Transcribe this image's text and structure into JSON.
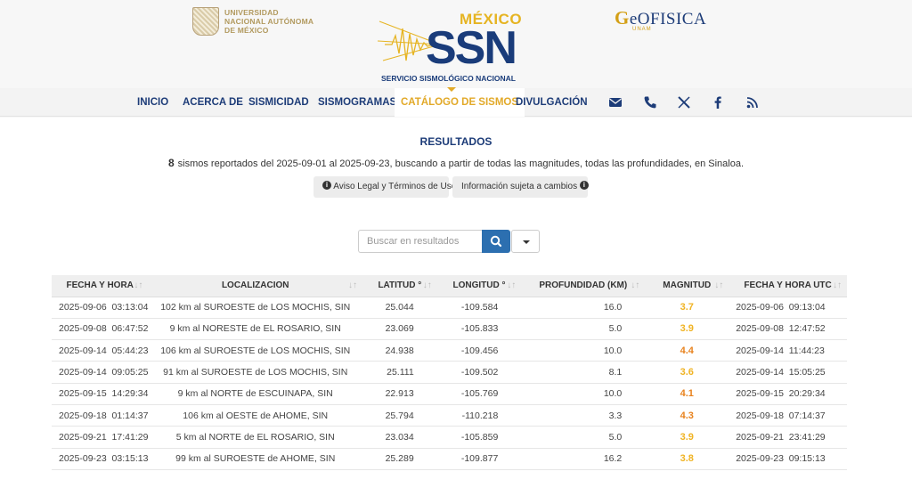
{
  "header": {
    "unam_text": "UNIVERSIDAD NACIONAL AUTÓNOMA DE MÉXICO",
    "ssn_top": "MÉXICO",
    "ssn_big": "SSN",
    "ssn_sub": "SERVICIO SISMOLÓGICO NACIONAL",
    "geo_g": "G",
    "geo_rest": "eOFISICA",
    "geo_sub": "UNAM"
  },
  "nav": {
    "items": [
      "INICIO",
      "ACERCA DE",
      "SISMICIDAD",
      "SISMOGRAMAS",
      "CATÁLOGO DE SISMOS",
      "DIVULGACIÓN"
    ],
    "active": "CATÁLOGO DE SISMOS",
    "icons": [
      "email-icon",
      "phone-icon",
      "x-twitter-icon",
      "facebook-icon",
      "rss-icon"
    ]
  },
  "results": {
    "title": "RESULTADOS",
    "count": "8",
    "description": "sismos reportados del 2025-09-01 al 2025-09-23, buscando a partir de todas las magnitudes, todas las profundidades, en Sinaloa.",
    "legal_label": "Aviso Legal y Términos de Uso",
    "changes_label": "Información sujeta a cambios",
    "info_glyph": "i"
  },
  "search": {
    "placeholder": "Buscar en resultados"
  },
  "colors": {
    "primary": "#1d3c78",
    "accent": "#e2a928",
    "button": "#2c6fb0",
    "mag_mid": "#f0b323",
    "mag_high": "#e8821d"
  },
  "table": {
    "sort_glyph": "↓↑",
    "headers": [
      "FECHA Y HORA",
      "LOCALIZACION",
      "LATITUD °",
      "LONGITUD °",
      "PROFUNDIDAD (KM)",
      "MAGNITUD",
      "FECHA Y HORA UTC"
    ],
    "rows": [
      [
        "2025-09-06  03:13:04",
        "102 km al SUROESTE de LOS MOCHIS, SIN",
        "25.044",
        "-109.584",
        "16.0",
        "3.7",
        "2025-09-06  09:13:04"
      ],
      [
        "2025-09-08  06:47:52",
        "9 km al NORESTE de EL ROSARIO, SIN",
        "23.069",
        "-105.833",
        "5.0",
        "3.9",
        "2025-09-08  12:47:52"
      ],
      [
        "2025-09-14  05:44:23",
        "106 km al SUROESTE de LOS MOCHIS, SIN",
        "24.938",
        "-109.456",
        "10.0",
        "4.4",
        "2025-09-14  11:44:23"
      ],
      [
        "2025-09-14  09:05:25",
        "91 km al SUROESTE de LOS MOCHIS, SIN",
        "25.111",
        "-109.502",
        "8.1",
        "3.6",
        "2025-09-14  15:05:25"
      ],
      [
        "2025-09-15  14:29:34",
        "9 km al NORTE de ESCUINAPA, SIN",
        "22.913",
        "-105.769",
        "10.0",
        "4.1",
        "2025-09-15  20:29:34"
      ],
      [
        "2025-09-18  01:14:37",
        "106 km al OESTE de AHOME, SIN",
        "25.794",
        "-110.218",
        "3.3",
        "4.3",
        "2025-09-18  07:14:37"
      ],
      [
        "2025-09-21  17:41:29",
        "5 km al NORTE de EL ROSARIO, SIN",
        "23.034",
        "-105.859",
        "5.0",
        "3.9",
        "2025-09-21  23:41:29"
      ],
      [
        "2025-09-23  03:15:13",
        "99 km al SUROESTE de AHOME, SIN",
        "25.289",
        "-109.877",
        "16.2",
        "3.8",
        "2025-09-23  09:15:13"
      ]
    ]
  }
}
